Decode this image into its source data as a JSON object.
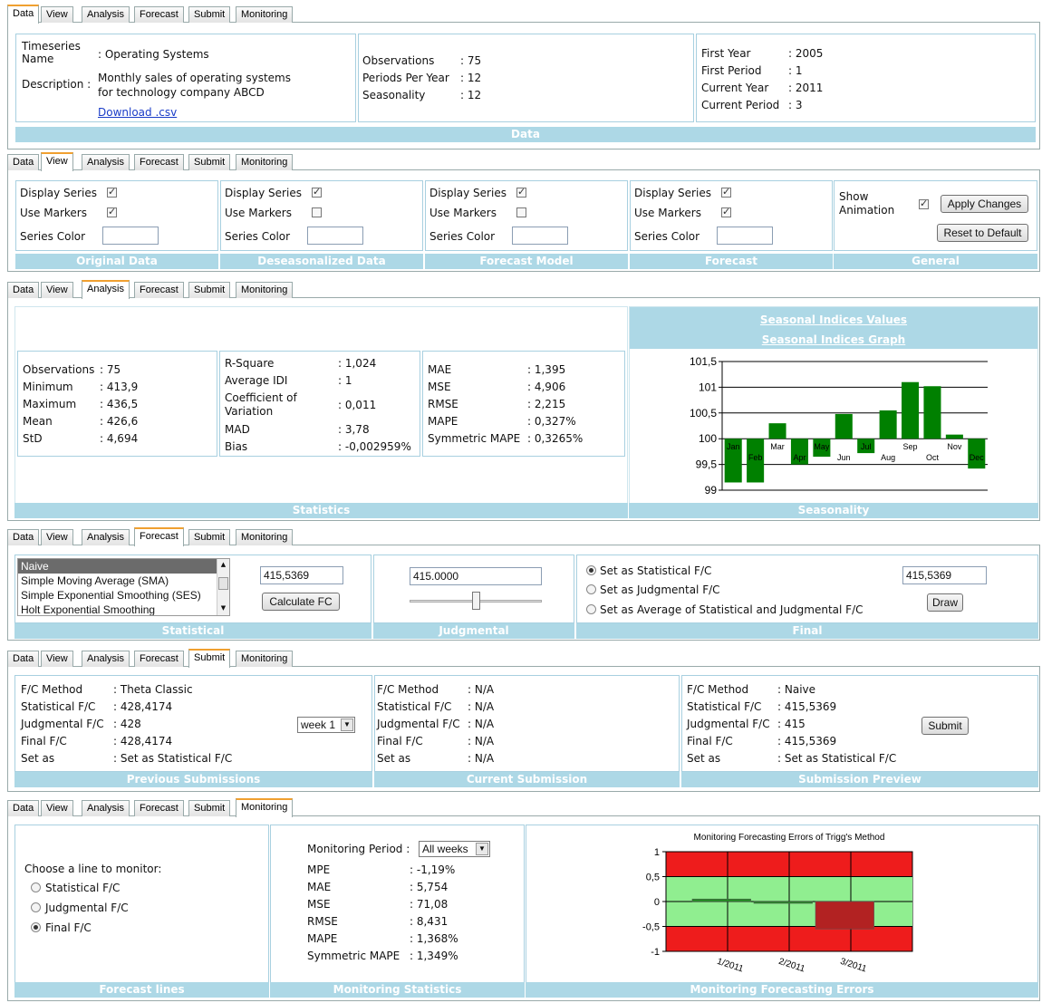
{
  "tabs": [
    "Data",
    "View",
    "Analysis",
    "Forecast",
    "Submit",
    "Monitoring"
  ],
  "data_section": {
    "ts_name_label": "Timeseries Name",
    "ts_name_value": ": Operating Systems",
    "desc_label": "Description :",
    "desc_line1": "Monthly sales of operating systems",
    "desc_line2": "for technology company ABCD",
    "download": "Download .csv",
    "mid": [
      {
        "label": "Observations",
        "value": ": 75"
      },
      {
        "label": "Periods Per Year",
        "value": ": 12"
      },
      {
        "label": "Seasonality",
        "value": ": 12"
      }
    ],
    "right": [
      {
        "label": "First Year",
        "value": ": 2005"
      },
      {
        "label": "First Period",
        "value": ": 1"
      },
      {
        "label": "Current Year",
        "value": ": 2011"
      },
      {
        "label": "Current Period",
        "value": ": 3"
      }
    ],
    "footer": "Data"
  },
  "view_section": {
    "display_series": "Display Series",
    "use_markers": "Use Markers",
    "series_color": "Series Color",
    "panels": [
      {
        "footer": "Original Data",
        "display": true,
        "markers": true
      },
      {
        "footer": "Deseasonalized Data",
        "display": true,
        "markers": false
      },
      {
        "footer": "Forecast Model",
        "display": true,
        "markers": false
      },
      {
        "footer": "Forecast",
        "display": true,
        "markers": true
      }
    ],
    "general": {
      "show_animation": "Show Animation",
      "show_animation_1": "Show",
      "show_animation_2": "Animation",
      "apply": "Apply Changes",
      "reset": "Reset to Default",
      "footer": "General"
    }
  },
  "analysis_section": {
    "stats1": [
      {
        "label": "Observations",
        "value": ": 75"
      },
      {
        "label": "Minimum",
        "value": ": 413,9"
      },
      {
        "label": "Maximum",
        "value": ": 436,5"
      },
      {
        "label": "Mean",
        "value": ": 426,6"
      },
      {
        "label": "StD",
        "value": ": 4,694"
      }
    ],
    "stats2": {
      "rsq_label": "R-Square",
      "rsq_value": ": 1,024",
      "idi_label": "Average IDI",
      "idi_value": ": 1",
      "cov_label1": "Coefficient of",
      "cov_label2": "Variation",
      "cov_value": ": 0,011",
      "mad_label": "MAD",
      "mad_value": ": 3,78",
      "bias_label": "Bias",
      "bias_value": ": -0,002959%"
    },
    "stats3": [
      {
        "label": "MAE",
        "value": ": 1,395"
      },
      {
        "label": "MSE",
        "value": ": 4,906"
      },
      {
        "label": "RMSE",
        "value": ": 2,215"
      },
      {
        "label": "MAPE",
        "value": ": 0,327%"
      },
      {
        "label": "Symmetric MAPE",
        "value": ": 0,3265%"
      }
    ],
    "stats_footer": "Statistics",
    "seasonal_values_link": "Seasonal Indices Values",
    "seasonal_graph_link": "Seasonal Indices Graph",
    "season_footer": "Seasonality"
  },
  "forecast_section": {
    "methods": [
      "Naive",
      "Simple Moving Average (SMA)",
      "Simple Exponential Smoothing (SES)",
      "Holt Exponential Smoothing"
    ],
    "stat_value": "415,5369",
    "calc_btn": "Calculate FC",
    "judg_value": "415.0000",
    "slider_level": 0.5,
    "radios": [
      "Set as Statistical F/C",
      "Set as Judgmental F/C",
      "Set as Average of Statistical and Judgmental F/C"
    ],
    "final_value": "415,5369",
    "draw_btn": "Draw",
    "footer_stat": "Statistical",
    "footer_judg": "Judgmental",
    "footer_final": "Final"
  },
  "submit_section": {
    "labels": [
      "F/C Method",
      "Statistical F/C",
      "Judgmental F/C",
      "Final F/C",
      "Set as"
    ],
    "previous": [
      ": Theta Classic",
      ": 428,4174",
      ": 428",
      ": 428,4174",
      ": Set as Statistical F/C"
    ],
    "current": [
      ": N/A",
      ": N/A",
      ": N/A",
      ": N/A",
      ": N/A"
    ],
    "preview": [
      ": Naive",
      ": 415,5369",
      ": 415",
      ": 415,5369",
      ": Set as Statistical F/C"
    ],
    "week_select": "week 1",
    "submit_btn": "Submit",
    "footer_prev": "Previous Submissions",
    "footer_cur": "Current Submission",
    "footer_prev2": "Submission Preview"
  },
  "monitoring_section": {
    "choose": "Choose a line to monitor:",
    "lines": [
      "Statistical F/C",
      "Judgmental F/C",
      "Final F/C"
    ],
    "period_label": "Monitoring Period :",
    "period_value": "All weeks",
    "stats": [
      {
        "label": "MPE",
        "value": ": -1,19%"
      },
      {
        "label": "MAE",
        "value": ": 5,754"
      },
      {
        "label": "MSE",
        "value": ": 71,08"
      },
      {
        "label": "RMSE",
        "value": ": 8,431"
      },
      {
        "label": "MAPE",
        "value": ": 1,368%"
      },
      {
        "label": "Symmetric MAPE",
        "value": ": 1,349%"
      }
    ],
    "footer_lines": "Forecast lines",
    "footer_stats": "Monitoring Statistics",
    "footer_errors": "Monitoring Forecasting Errors"
  },
  "chart_data": [
    {
      "type": "bar",
      "categories": [
        "Jan",
        "Feb",
        "Mar",
        "Apr",
        "May",
        "Jun",
        "Jul",
        "Aug",
        "Sep",
        "Oct",
        "Nov",
        "Dec"
      ],
      "values": [
        99.15,
        99.15,
        100.3,
        99.5,
        99.65,
        100.48,
        99.72,
        100.55,
        101.1,
        101.02,
        100.08,
        99.42
      ],
      "baseline": 100,
      "ylim": [
        99,
        101.5
      ],
      "yticks": [
        "99",
        "99,5",
        "100",
        "100,5",
        "101",
        "101,5"
      ],
      "bar_color": "#008000"
    },
    {
      "type": "bar",
      "title": "Monitoring Forecasting Errors of Trigg's Method",
      "categories": [
        "1/2011",
        "2/2011",
        "3/2011"
      ],
      "values": [
        0.05,
        -0.02,
        -0.55
      ],
      "ylim": [
        -1,
        1
      ],
      "yticks": [
        "-1",
        "-0,5",
        "0",
        "0,5",
        "1"
      ],
      "outer_band_color": "#ee1c1c",
      "inner_band_color": "#90ee90",
      "bar_color": "#b22222"
    }
  ]
}
